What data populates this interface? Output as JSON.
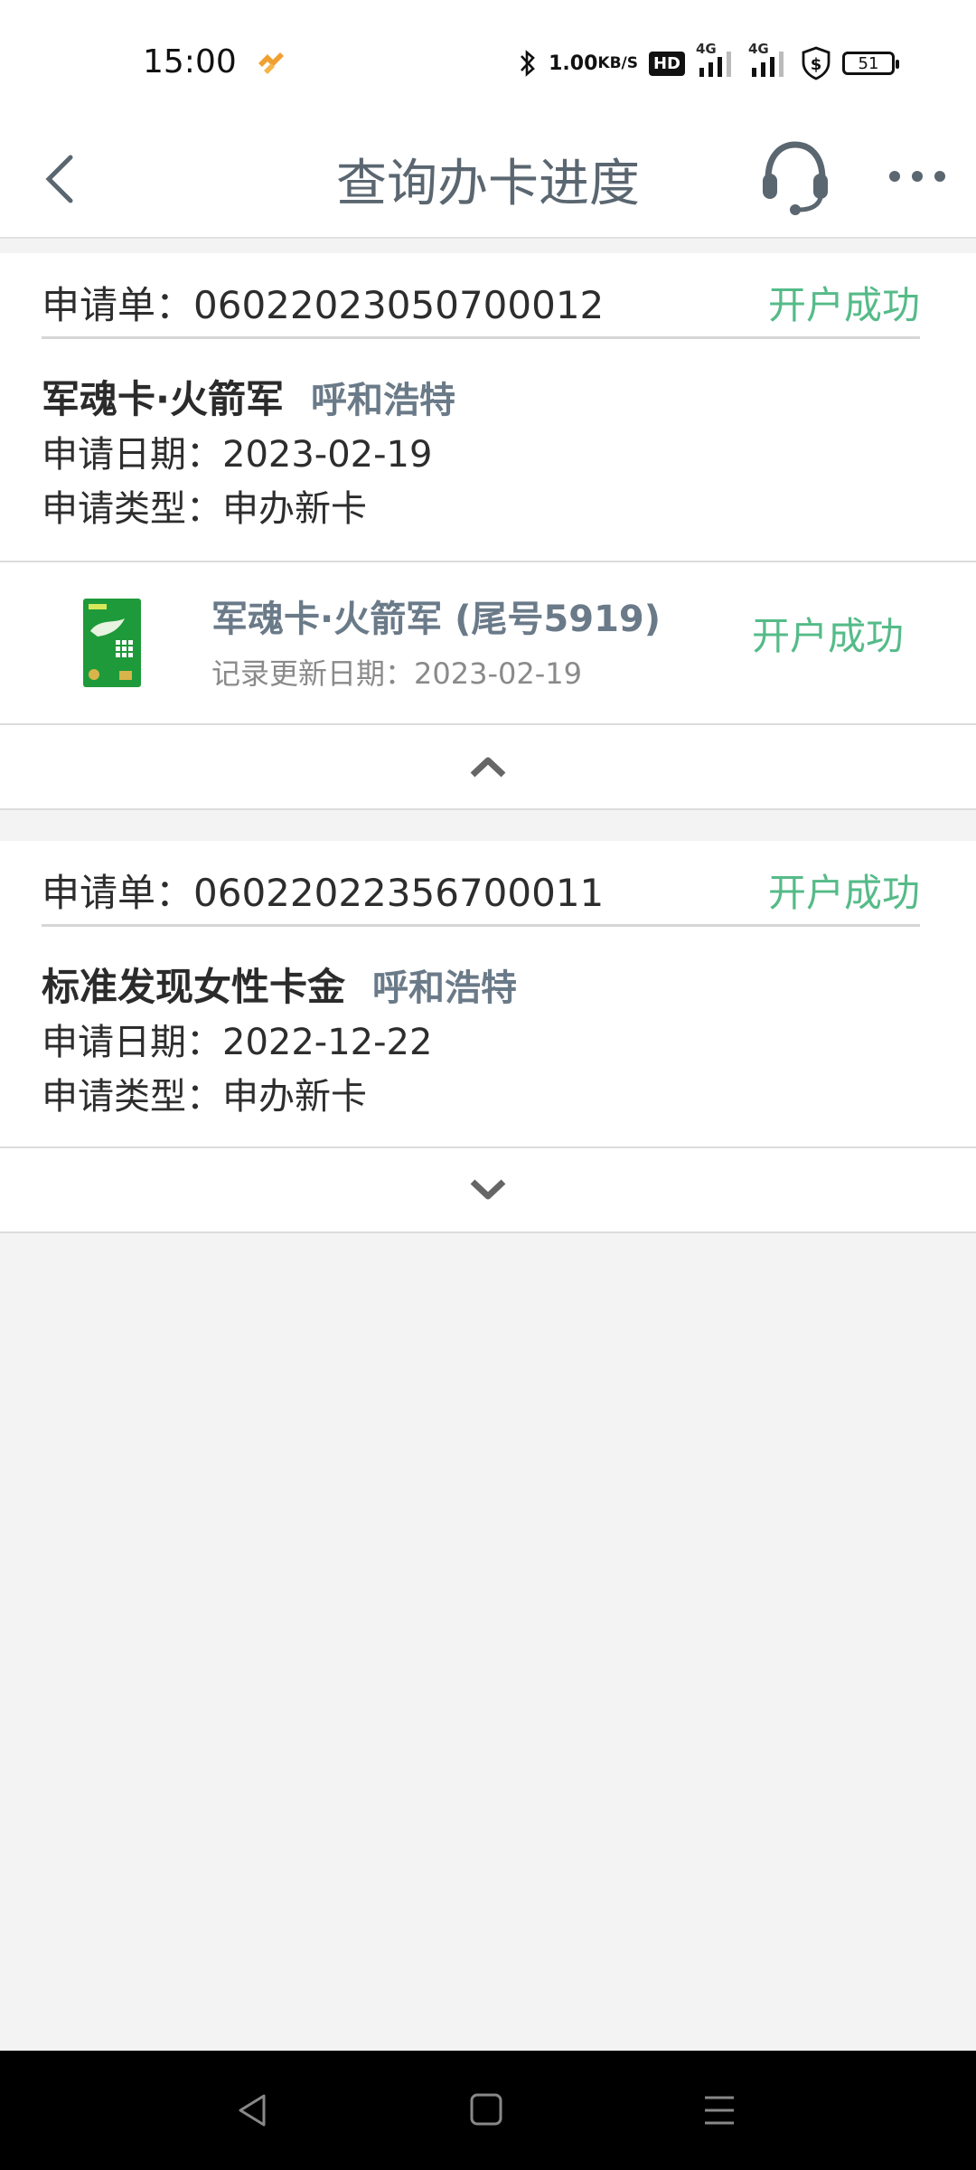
{
  "status_bar": {
    "time": "15:00",
    "speed_value": "1.00",
    "speed_unit": "KB/S",
    "hd_label": "HD",
    "signal1_label": "4G",
    "signal2_label": "4G",
    "battery": "51",
    "icons": [
      "app-notification-icon",
      "bluetooth-icon",
      "signal-icon",
      "shield-dollar-icon",
      "battery-icon"
    ]
  },
  "header": {
    "title": "查询办卡进度",
    "icons": [
      "back-icon",
      "customer-service-icon",
      "more-icon"
    ]
  },
  "applications": [
    {
      "order_label": "申请单：06022023050700012",
      "status": "开户成功",
      "card_name": "军魂卡·火箭军",
      "city": "呼和浩特",
      "date_line": "申请日期：2023-02-19",
      "type_line": "申请类型：申办新卡",
      "expanded": true,
      "product": {
        "name": "军魂卡·火箭军 (尾号5919)",
        "update_line": "记录更新日期：2023-02-19",
        "status": "开户成功"
      }
    },
    {
      "order_label": "申请单：06022022356700011",
      "status": "开户成功",
      "card_name": "标准发现女性卡金",
      "city": "呼和浩特",
      "date_line": "申请日期：2022-12-22",
      "type_line": "申请类型：申办新卡",
      "expanded": false
    }
  ],
  "colors": {
    "success": "#55bb88",
    "title": "#5a6670",
    "background": "#f3f3f3",
    "card_green": "#1f9a3a"
  },
  "nav_bar": {
    "icons": [
      "nav-back-icon",
      "nav-home-icon",
      "nav-menu-icon"
    ]
  }
}
